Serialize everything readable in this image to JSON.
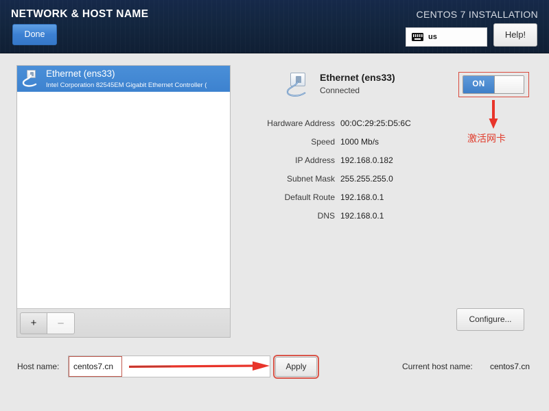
{
  "header": {
    "title": "NETWORK & HOST NAME",
    "install_title": "CENTOS 7 INSTALLATION",
    "done_label": "Done",
    "help_label": "Help!",
    "keyboard_layout": "us",
    "keyboard_icon": "keyboard-icon"
  },
  "device_list": {
    "items": [
      {
        "name": "Ethernet (ens33)",
        "description": "Intel Corporation 82545EM Gigabit Ethernet Controller (",
        "icon": "ethernet-icon",
        "selected": true
      }
    ],
    "add_label": "+",
    "remove_label": "–"
  },
  "detail": {
    "name": "Ethernet (ens33)",
    "status": "Connected",
    "icon": "ethernet-icon",
    "rows": [
      {
        "label": "Hardware Address",
        "value": "00:0C:29:25:D5:6C"
      },
      {
        "label": "Speed",
        "value": "1000 Mb/s"
      },
      {
        "label": "IP Address",
        "value": "192.168.0.182"
      },
      {
        "label": "Subnet Mask",
        "value": "255.255.255.0"
      },
      {
        "label": "Default Route",
        "value": "192.168.0.1"
      },
      {
        "label": "DNS",
        "value": "192.168.0.1"
      }
    ]
  },
  "toggle": {
    "state_label": "ON",
    "annotation_text": "激活网卡"
  },
  "configure": {
    "label": "Configure..."
  },
  "hostname": {
    "label": "Host name:",
    "value": "centos7.cn",
    "placeholder": "",
    "apply_label": "Apply",
    "current_label": "Current host name:",
    "current_value": "centos7.cn"
  },
  "colors": {
    "header_bg": "#13263f",
    "accent_blue": "#3d82cf",
    "annotation_red": "#e03a2a",
    "page_bg": "#e8e8e8"
  }
}
